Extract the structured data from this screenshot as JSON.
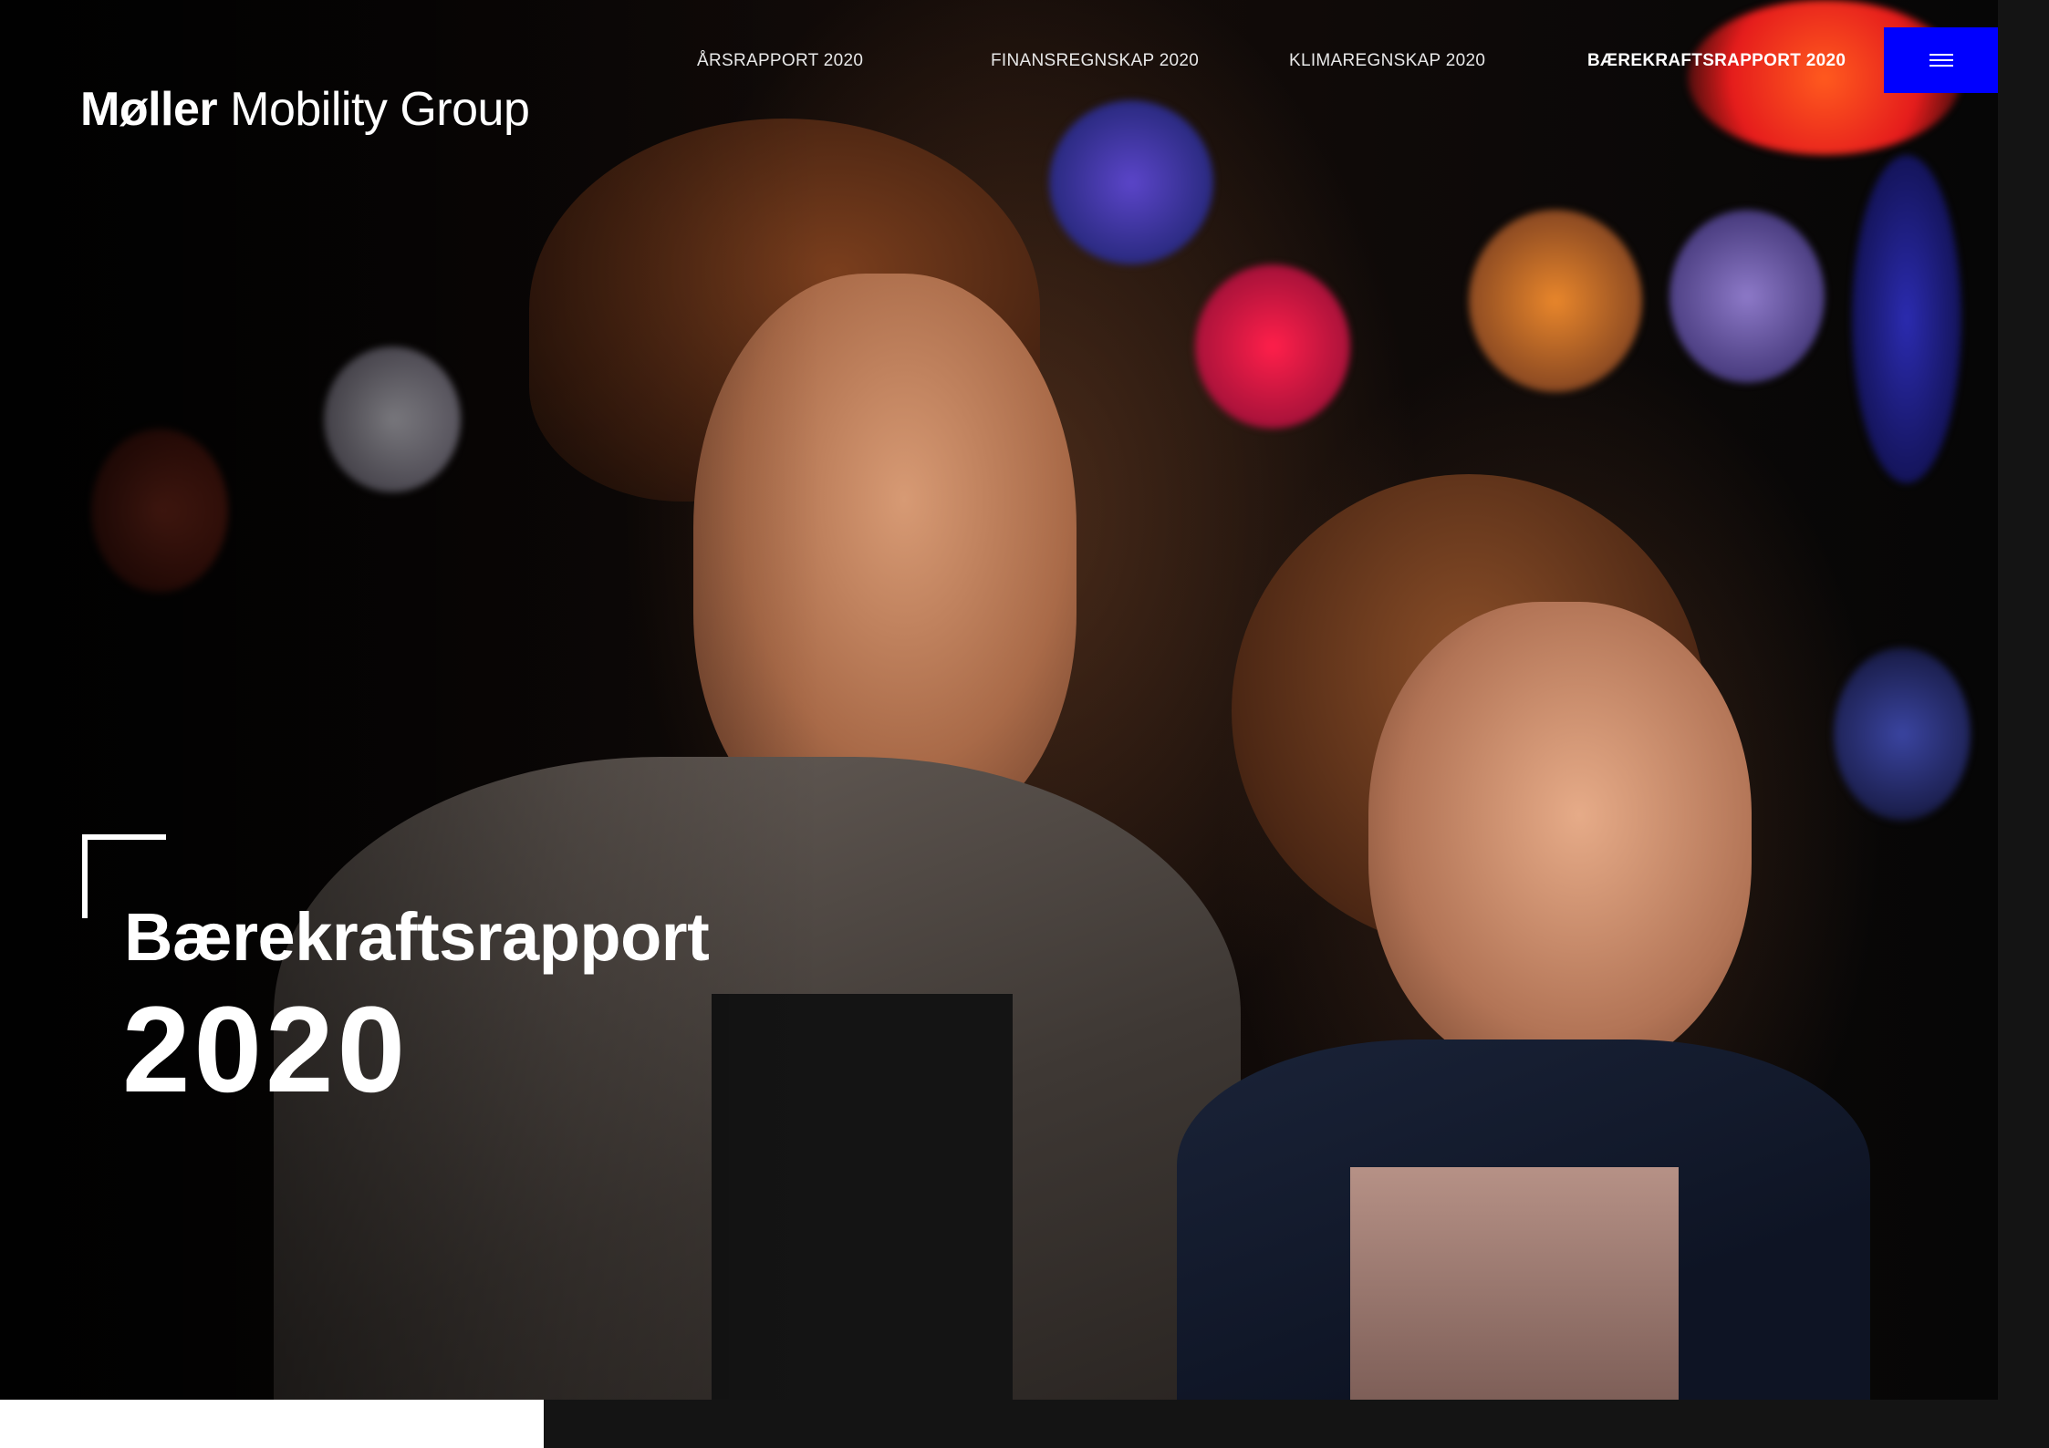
{
  "header": {
    "logo": {
      "brand": "Møller",
      "rest": "Mobility Group"
    },
    "nav": [
      {
        "label": "ÅRSRAPPORT 2020",
        "active": false
      },
      {
        "label": "FINANSREGNSKAP 2020",
        "active": false
      },
      {
        "label": "KLIMAREGNSKAP 2020",
        "active": false
      },
      {
        "label": "BÆREKRAFTSRAPPORT 2020",
        "active": true
      }
    ],
    "menu_button": {
      "icon": "hamburger-menu-icon",
      "color": "#0000ff"
    }
  },
  "hero": {
    "title": "Bærekraftsrapport",
    "year": "2020"
  },
  "colors": {
    "accent": "#0000ff",
    "background": "#000000",
    "footer_bar": "#141414"
  }
}
